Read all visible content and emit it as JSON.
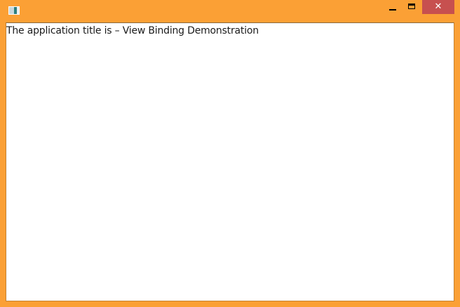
{
  "window": {
    "frame_color": "#fba035",
    "close_button_color": "#c7504f",
    "app_icon": "window-app-icon"
  },
  "titlebar": {
    "minimize_icon": "minimize-icon",
    "maximize_icon": "maximize-icon",
    "close_icon": "close-icon",
    "close_glyph": "✕"
  },
  "content": {
    "prefix": "The application title is –",
    "title": "View Binding Demonstration"
  }
}
